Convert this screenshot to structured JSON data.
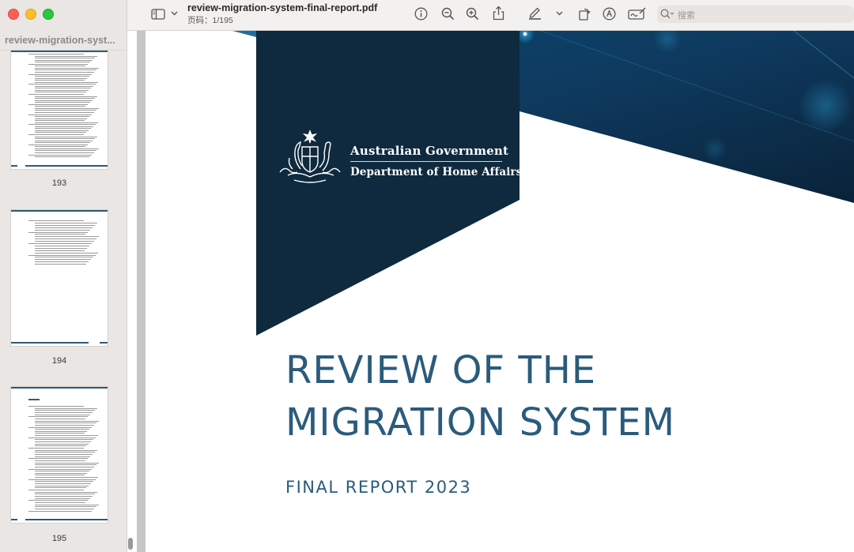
{
  "window": {
    "doc_title": "review-migration-system-final-report.pdf",
    "page_indicator": "页码：1/195"
  },
  "sidebar": {
    "title": "review-migration-syst...",
    "thumbnails": [
      {
        "page": "193"
      },
      {
        "page": "194"
      },
      {
        "page": "195"
      }
    ]
  },
  "toolbar": {
    "search_placeholder": "搜索",
    "icons": [
      "sidebar-toggle-icon",
      "chevron-down-icon",
      "info-icon",
      "zoom-out-icon",
      "zoom-in-icon",
      "share-icon",
      "highlight-pen-icon",
      "chevron-down-icon",
      "rotate-icon",
      "markup-icon",
      "signature-icon",
      "search-icon"
    ]
  },
  "document": {
    "gov_line1": "Australian Government",
    "gov_line2": "Department of Home Affairs",
    "title_line1": "REVIEW OF THE",
    "title_line2": "MIGRATION SYSTEM",
    "subtitle": "FINAL REPORT 2023"
  },
  "colors": {
    "banner_navy": "#0f2a3e",
    "title_blue": "#2a5b7c",
    "accent_teal": "#1f6f9e"
  }
}
